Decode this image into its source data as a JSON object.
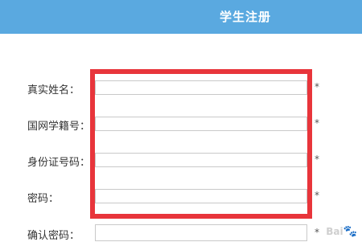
{
  "header": {
    "title": "学生注册"
  },
  "form": {
    "fields": [
      {
        "label": "真实姓名：",
        "value": "",
        "required_mark": "*"
      },
      {
        "label": "国网学籍号：",
        "value": "",
        "required_mark": "*"
      },
      {
        "label": "身份证号码：",
        "value": "",
        "required_mark": "*"
      },
      {
        "label": "密码：",
        "value": "",
        "required_mark": "*"
      },
      {
        "label": "确认密码：",
        "value": "",
        "required_mark": "*"
      }
    ]
  },
  "annotation": {
    "highlight_color": "#e8353b"
  },
  "watermark": {
    "text": "Bai",
    "icon": "paw-icon"
  },
  "colors": {
    "header_bg": "#5aa9e0",
    "header_text": "#ffffff"
  }
}
